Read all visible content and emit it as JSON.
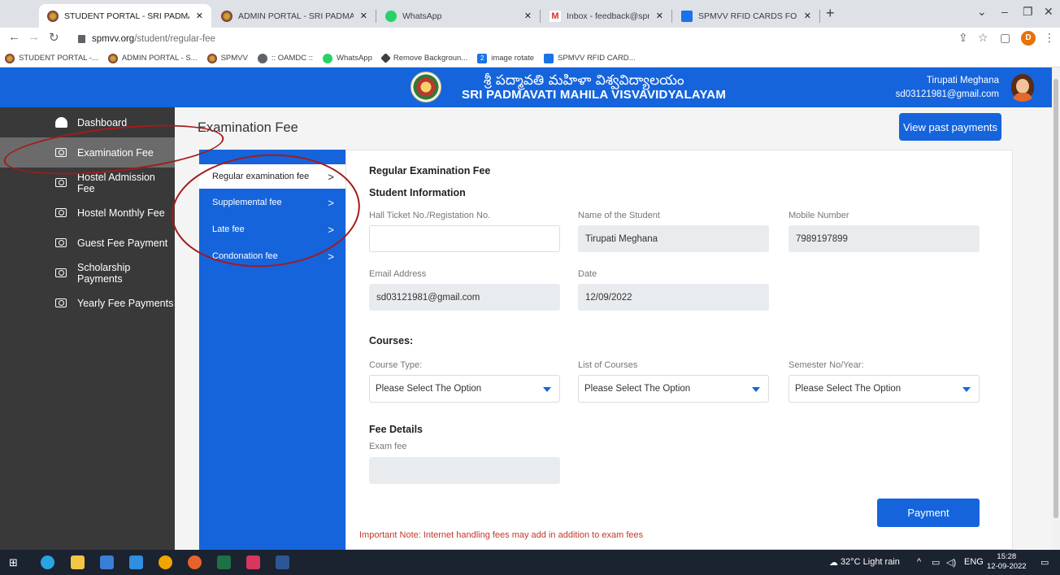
{
  "browser": {
    "tabs": [
      {
        "label": "STUDENT PORTAL - SRI PADMAV",
        "active": true
      },
      {
        "label": "ADMIN PORTAL - SRI PADMAVAT"
      },
      {
        "label": "WhatsApp"
      },
      {
        "label": "Inbox - feedback@spmvv.ac.in -"
      },
      {
        "label": "SPMVV RFID CARDS FOR STAFF -"
      }
    ],
    "url_host": "spmvv.org",
    "url_path": "/student/regular-fee",
    "profile_initial": "D",
    "bookmarks": [
      {
        "label": "STUDENT PORTAL -..."
      },
      {
        "label": "ADMIN PORTAL - S..."
      },
      {
        "label": "SPMVV"
      },
      {
        "label": ":: OAMDC ::"
      },
      {
        "label": "WhatsApp"
      },
      {
        "label": "Remove Backgroun..."
      },
      {
        "label": "image rotate"
      },
      {
        "label": "SPMVV RFID CARD..."
      }
    ]
  },
  "header": {
    "title_telugu": "శ్రీ పద్మావతి మహిళా విశ్వవిద్యాలయం",
    "title_english": "SRI PADMAVATI MAHILA VISVAVIDYALAYAM",
    "user_name": "Tirupati Meghana",
    "user_email": "sd03121981@gmail.com"
  },
  "sidebar": {
    "items": [
      {
        "label": "Dashboard",
        "icon": "dashboard-icon"
      },
      {
        "label": "Examination Fee",
        "icon": "money-icon",
        "active": true
      },
      {
        "label": "Hostel Admission Fee",
        "icon": "money-icon"
      },
      {
        "label": "Hostel Monthly Fee",
        "icon": "money-icon"
      },
      {
        "label": "Guest Fee Payment",
        "icon": "money-icon"
      },
      {
        "label": "Scholarship Payments",
        "icon": "money-icon"
      },
      {
        "label": "Yearly Fee Payments",
        "icon": "money-icon"
      }
    ]
  },
  "main": {
    "page_title": "Examination Fee",
    "past_payments_label": "View past payments",
    "subnav": [
      {
        "label": "Regular examination fee",
        "active": true
      },
      {
        "label": "Supplemental fee"
      },
      {
        "label": "Late fee"
      },
      {
        "label": "Condonation fee"
      }
    ],
    "chevron": ">",
    "form": {
      "heading": "Regular Examination Fee",
      "student_info_heading": "Student Information",
      "hall_ticket_label": "Hall Ticket No./Registation No.",
      "hall_ticket_value": "",
      "name_label": "Name of the Student",
      "name_value": "Tirupati Meghana",
      "mobile_label": "Mobile Number",
      "mobile_value": "7989197899",
      "email_label": "Email Address",
      "email_value": "sd03121981@gmail.com",
      "date_label": "Date",
      "date_value": "12/09/2022",
      "courses_heading": "Courses:",
      "course_type_label": "Course Type:",
      "course_type_value": "Please Select The Option",
      "course_list_label": "List of Courses",
      "course_list_value": "Please Select The Option",
      "semester_label": "Semester No/Year:",
      "semester_value": "Please Select The Option",
      "fee_heading": "Fee Details",
      "exam_fee_label": "Exam fee",
      "exam_fee_value": "",
      "payment_label": "Payment",
      "note": "Important Note: Internet handling fees may add in addition to exam fees"
    }
  },
  "taskbar": {
    "weather": "32°C  Light rain",
    "lang": "ENG",
    "time": "15:28",
    "date": "12-09-2022"
  },
  "colors": {
    "primary": "#1564dc",
    "sidebar": "#393939",
    "annotation": "#a31b1b",
    "note": "#c0392b"
  }
}
